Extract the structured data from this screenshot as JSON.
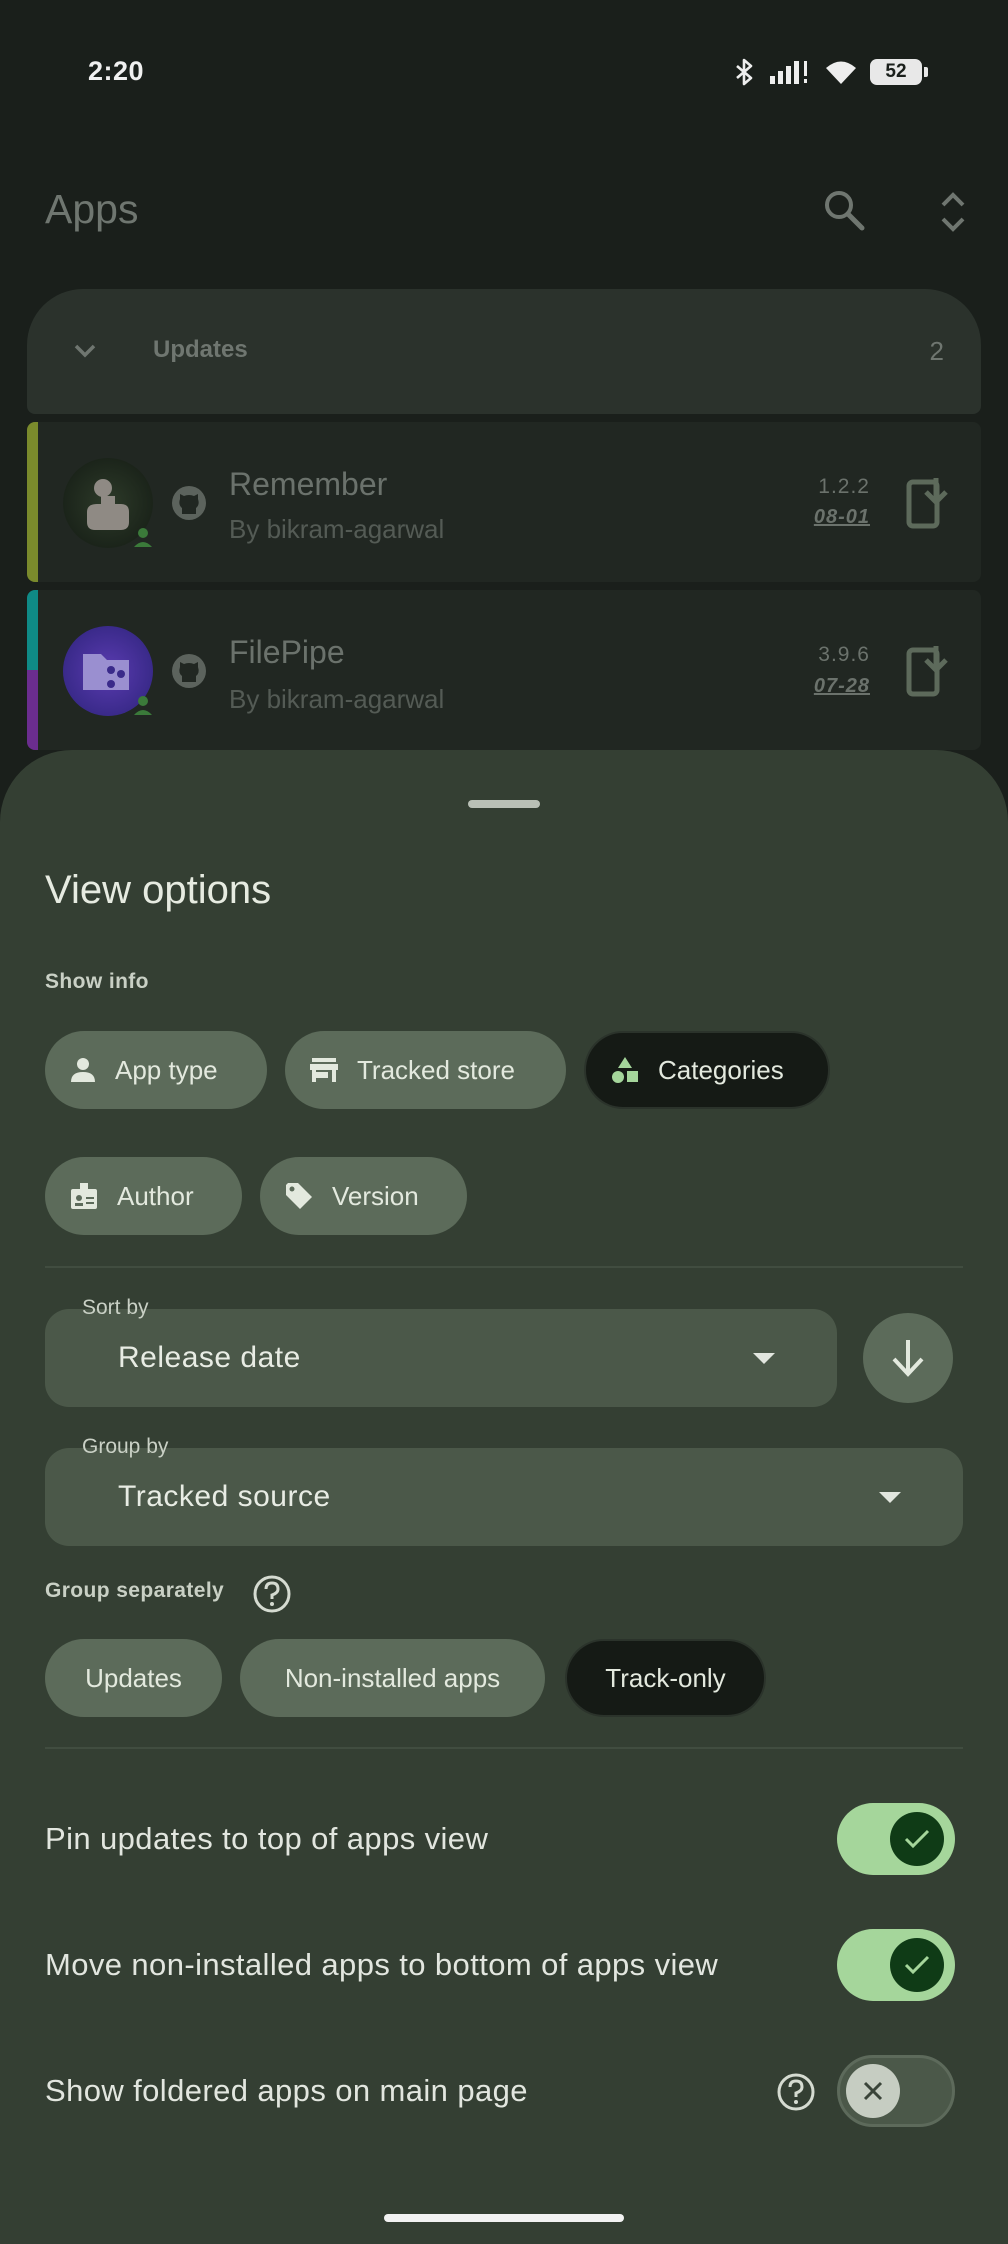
{
  "status_bar": {
    "time": "2:20",
    "battery": "52"
  },
  "app_bar": {
    "title": "Apps"
  },
  "updates_section": {
    "label": "Updates",
    "count": "2"
  },
  "apps": [
    {
      "name": "Remember",
      "author": "By bikram-agarwal",
      "version": "1.2.2",
      "date": "08-01"
    },
    {
      "name": "FilePipe",
      "author": "By bikram-agarwal",
      "version": "3.9.6",
      "date": "07-28"
    }
  ],
  "sheet": {
    "title": "View options",
    "show_info_label": "Show info",
    "show_info_chips": [
      {
        "label": "App type",
        "icon": "person-icon",
        "selected": false
      },
      {
        "label": "Tracked store",
        "icon": "store-icon",
        "selected": false
      },
      {
        "label": "Categories",
        "icon": "category-shapes-icon",
        "selected": true
      },
      {
        "label": "Author",
        "icon": "badge-icon",
        "selected": false
      },
      {
        "label": "Version",
        "icon": "tag-icon",
        "selected": false
      }
    ],
    "sort_by": {
      "label": "Sort by",
      "value": "Release date"
    },
    "group_by": {
      "label": "Group by",
      "value": "Tracked source"
    },
    "group_separately_label": "Group separately",
    "group_chips": [
      {
        "label": "Updates",
        "selected": false
      },
      {
        "label": "Non-installed apps",
        "selected": false
      },
      {
        "label": "Track-only",
        "selected": true
      }
    ],
    "toggles": [
      {
        "label": "Pin updates to top of apps view",
        "on": true
      },
      {
        "label": "Move non-installed apps to bottom of apps view",
        "on": true
      },
      {
        "label": "Show foldered apps on main page",
        "on": false
      }
    ]
  },
  "colors": {
    "accent": "#a5d69b",
    "sheet": "#343f33",
    "background": "#1a1f1b"
  }
}
